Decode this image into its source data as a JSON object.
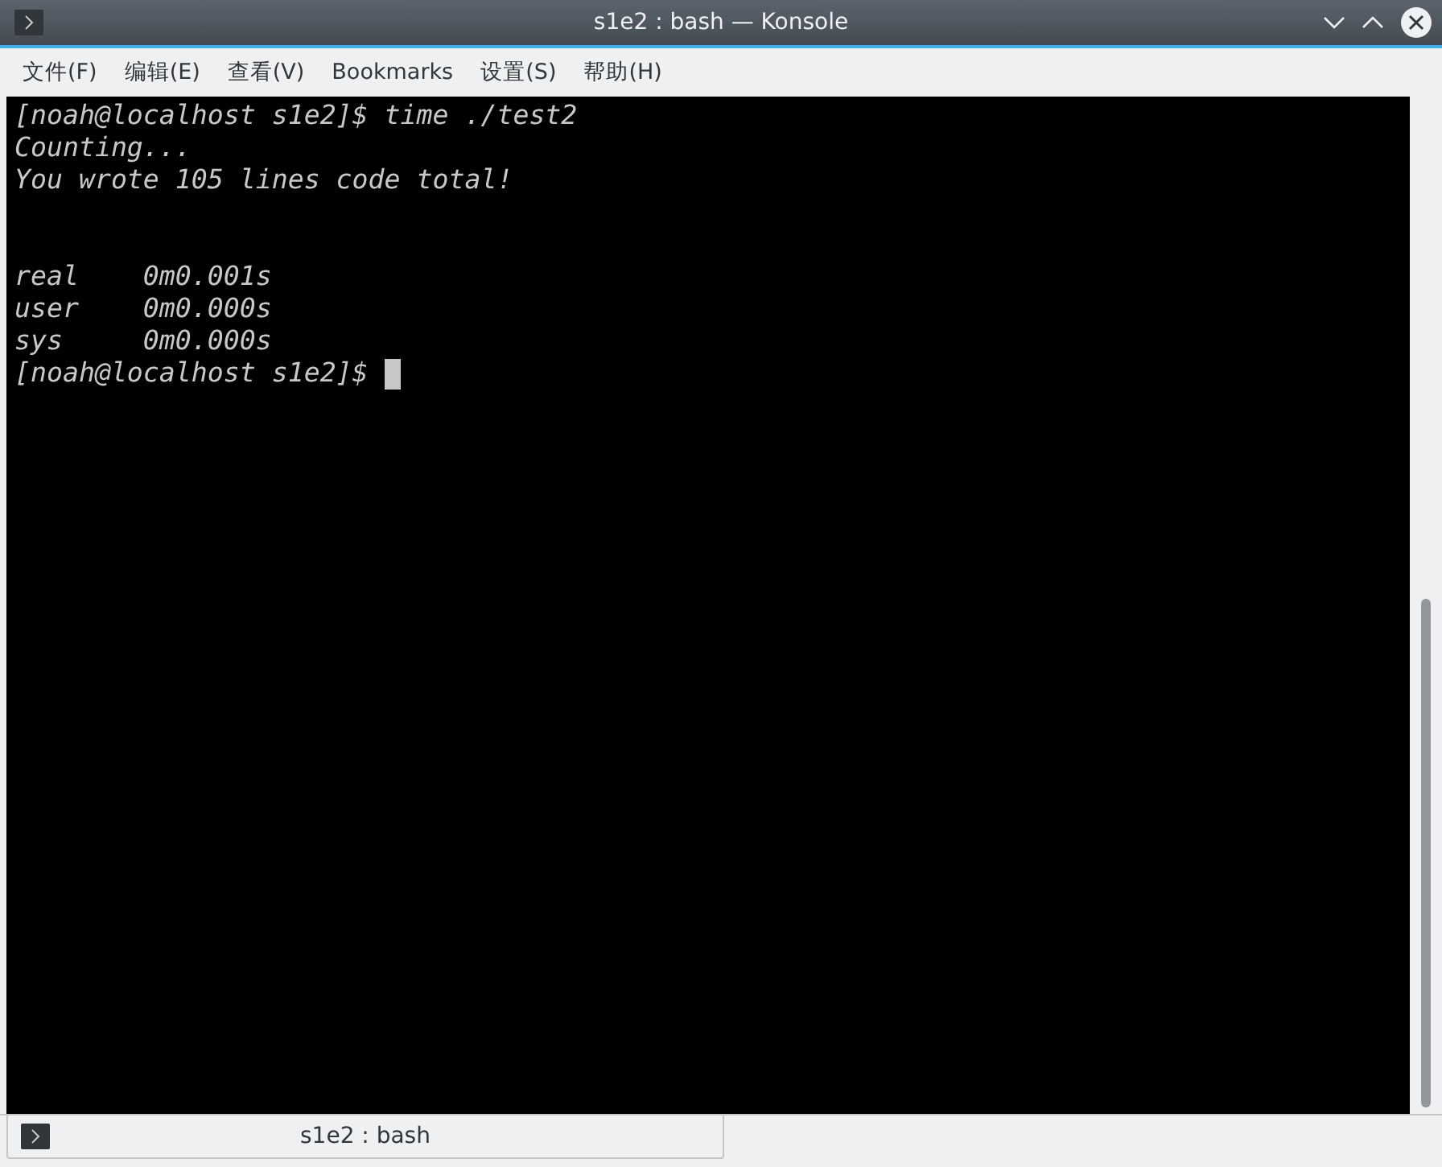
{
  "window": {
    "title": "s1e2 : bash — Konsole"
  },
  "menu": [
    "文件(F)",
    "编辑(E)",
    "查看(V)",
    "Bookmarks",
    "设置(S)",
    "帮助(H)"
  ],
  "terminal": {
    "lines": [
      {
        "kind": "text",
        "text": "[noah@localhost s1e2]$ time ./test2"
      },
      {
        "kind": "text",
        "text": "Counting..."
      },
      {
        "kind": "text",
        "text": "You wrote 105 lines code total!"
      },
      {
        "kind": "blank"
      },
      {
        "kind": "blank"
      },
      {
        "kind": "text",
        "text": "real    0m0.001s"
      },
      {
        "kind": "text",
        "text": "user    0m0.000s"
      },
      {
        "kind": "text",
        "text": "sys     0m0.000s"
      },
      {
        "kind": "prompt",
        "text": "[noah@localhost s1e2]$ "
      }
    ]
  },
  "tabs": [
    {
      "label": "s1e2 : bash",
      "selected": true
    }
  ]
}
